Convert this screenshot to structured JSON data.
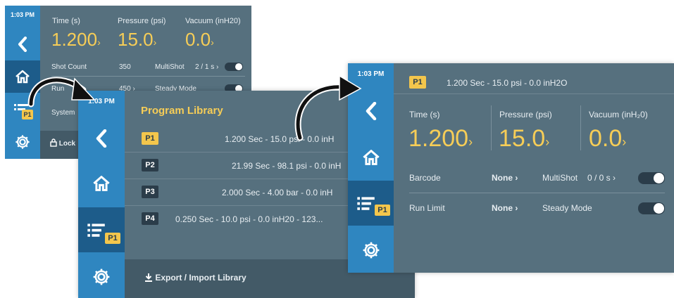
{
  "screen1": {
    "time": "1:03 PM",
    "headers": {
      "time": "Time (s)",
      "pressure": "Pressure (psi)",
      "vacuum": "Vacuum (inH20)"
    },
    "values": {
      "time": "1.200",
      "pressure": "15.0",
      "vacuum": "0.0",
      "chevron": "›"
    },
    "rows": {
      "shot_count_label": "Shot Count",
      "shot_count_value": "350",
      "multishot_label": "MultiShot",
      "multishot_value": "2 / 1 s ›",
      "run_label": "Run",
      "run_value": "450 ›",
      "steady_label": "Steady Mode",
      "system_label": "System",
      "lock_label": "Lock"
    },
    "badge": "P1"
  },
  "screen2": {
    "time": "1:03 PM",
    "title": "Program Library",
    "programs": [
      {
        "tag": "P1",
        "text": "1.200 Sec - 15.0 psi - 0.0 inH",
        "active": true
      },
      {
        "tag": "P2",
        "text": "21.99 Sec - 98.1 psi - 0.0 inH",
        "active": false
      },
      {
        "tag": "P3",
        "text": "2.000 Sec - 4.00 bar - 0.0 inH",
        "active": false
      },
      {
        "tag": "P4",
        "text": "0.250 Sec - 10.0 psi - 0.0 inH20 - 123...",
        "active": false
      }
    ],
    "footer": "Export / Import Library",
    "badge": "P1"
  },
  "screen3": {
    "time": "1:03 PM",
    "program_tag": "P1",
    "program_text": "1.200 Sec - 15.0 psi - 0.0 inH2O",
    "headers": {
      "time": "Time (s)",
      "pressure": "Pressure (psi)",
      "vacuum": "Vacuum (inH₂0)"
    },
    "values": {
      "time": "1.200",
      "pressure": "15.0",
      "vacuum": "0.0",
      "chevron": "›"
    },
    "rows": {
      "barcode_label": "Barcode",
      "barcode_value": "None ›",
      "multishot_label": "MultiShot",
      "multishot_value": "0 / 0 s ›",
      "run_limit_label": "Run Limit",
      "run_limit_value": "None ›",
      "steady_label": "Steady Mode"
    },
    "badge": "P1"
  }
}
